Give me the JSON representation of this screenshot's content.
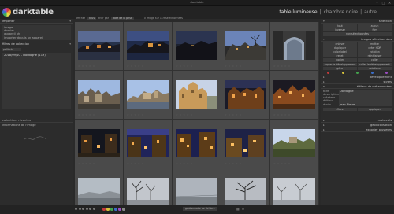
{
  "window": {
    "title": "darktable",
    "min": "–",
    "max": "□",
    "close": "×"
  },
  "app": {
    "logo_text": "darktable"
  },
  "views": {
    "lighttable": "table lumineuse",
    "separator": "|",
    "darkroom": "chambre noire",
    "separator2": "|",
    "other": "autre"
  },
  "filterbar": {
    "label": "afficher",
    "filter_value": "tous",
    "sort_label": "trier par",
    "sort_value": "date de la prise",
    "count": "0 image sur 119 sélectionnées"
  },
  "left_panel": {
    "import": {
      "title": "importer",
      "rows": [
        "image",
        "dossier",
        "appareil ph",
        "importer depuis un appareil"
      ]
    },
    "collections": {
      "title": "filtres de collection",
      "field": "pellicule",
      "list": [
        "2018/09/10 - Dordogne (119)"
      ]
    },
    "bottom": [
      "collections récentes",
      "informations de l'image"
    ]
  },
  "center": {
    "stars": "☆ ☆ ☆ ☆ ☆"
  },
  "right_panel": {
    "sections": {
      "selected": "sélection",
      "actions": "images sélectionnées",
      "styles": "développement",
      "styles_sub": "styles",
      "metadata": "éditeur de métadonnées",
      "tags": "mots-clés",
      "geo": "géolocalisation",
      "export": "exporter plusieurs"
    },
    "select_buttons": [
      "tout",
      "aucun",
      "inverser",
      "film",
      "non sélectionnées"
    ],
    "action_buttons": [
      "enlever",
      "mettre",
      "dupliquer",
      "créer HDR",
      "color label",
      "rotation",
      "reset",
      "réinitialiser",
      "copier",
      "coller",
      "copier le développement",
      "coller le développement",
      "gérer",
      "rotations"
    ],
    "metadata": [
      {
        "key": "titre",
        "value": "Dordogne"
      },
      {
        "key": "description",
        "value": ""
      },
      {
        "key": "créateur",
        "value": ""
      },
      {
        "key": "éditeur",
        "value": ""
      },
      {
        "key": "droits",
        "value": "Jean Pierre"
      }
    ],
    "metadata_buttons": [
      "effacer",
      "appliquer"
    ],
    "label_colors": [
      "#c23b3b",
      "#d6c23c",
      "#44a34e",
      "#3c6fc9",
      "#9b4ec2"
    ]
  },
  "bottombar": {
    "layout": "gestionnaire de fichiers",
    "label_colors": [
      "#c23b3b",
      "#d6c23c",
      "#44a34e",
      "#3c6fc9",
      "#9b4ec2",
      "#888888"
    ]
  }
}
